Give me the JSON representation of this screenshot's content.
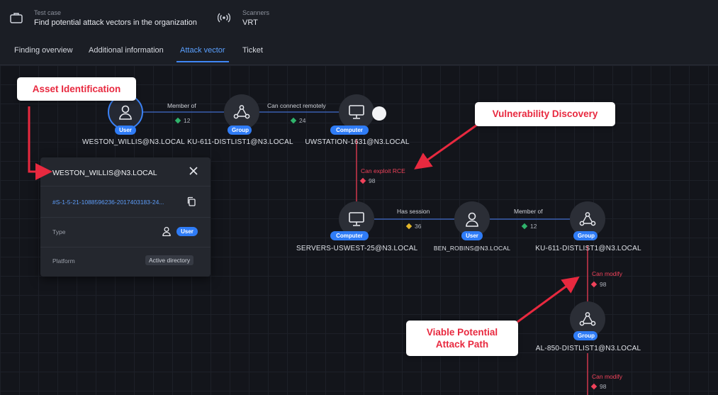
{
  "header": {
    "test_case_label": "Test case",
    "test_case_value": "Find potential attack vectors in the organization",
    "scanners_label": "Scanners",
    "scanners_value": "VRT",
    "test_case_icon": "briefcase-icon",
    "scanners_icon": "broadcast-icon"
  },
  "tabs": [
    {
      "label": "Finding overview",
      "active": false
    },
    {
      "label": "Additional information",
      "active": false
    },
    {
      "label": "Attack vector",
      "active": true
    },
    {
      "label": "Ticket",
      "active": false
    }
  ],
  "nodes": [
    {
      "type": "User",
      "name": "WESTON_WILLIS@N3.LOCAL",
      "icon": "user-icon"
    },
    {
      "type": "Group",
      "name": "KU-611-DISTLIST1@N3.LOCAL",
      "icon": "group-icon"
    },
    {
      "type": "Computer",
      "name": "UWSTATION-1631@N3.LOCAL",
      "icon": "monitor-icon"
    },
    {
      "type": "Computer",
      "name": "SERVERS-USWEST-25@N3.LOCAL",
      "icon": "monitor-icon"
    },
    {
      "type": "User",
      "name": "BEN_ROBINS@N3.LOCAL",
      "icon": "user-icon"
    },
    {
      "type": "Group",
      "name": "KU-611-DISTLIST1@N3.LOCAL",
      "icon": "group-icon"
    },
    {
      "type": "Group",
      "name": "AL-850-DISTLIST1@N3.LOCAL",
      "icon": "group-icon"
    }
  ],
  "edges": [
    {
      "label": "Member of",
      "count": "12",
      "color": "#2fb36b"
    },
    {
      "label": "Can connect remotely",
      "count": "24",
      "color": "#2fb36b"
    },
    {
      "label": "Can exploit RCE",
      "count": "98",
      "color": "#f0425a"
    },
    {
      "label": "Has session",
      "count": "36",
      "color": "#e3b62a"
    },
    {
      "label": "Member of",
      "count": "12",
      "color": "#2fb36b"
    },
    {
      "label": "Can modify",
      "count": "98",
      "color": "#f0425a"
    },
    {
      "label": "Can modify",
      "count": "98",
      "color": "#f0425a"
    }
  ],
  "popup": {
    "title": "WESTON_WILLIS@N3.LOCAL",
    "sid": "#S-1-5-21-1088596236-2017403183-24...",
    "type_label": "Type",
    "type_value": "User",
    "platform_label": "Platform",
    "platform_value": "Active directory"
  },
  "callouts": {
    "asset": "Asset Identification",
    "vuln": "Vulnerability Discovery",
    "path_line1": "Viable Potential",
    "path_line2": "Attack Path"
  },
  "colors": {
    "accent": "#3f86f5",
    "edge_line": "#3a5fb0",
    "attack": "#f0425a",
    "arrow": "#e8293f"
  }
}
